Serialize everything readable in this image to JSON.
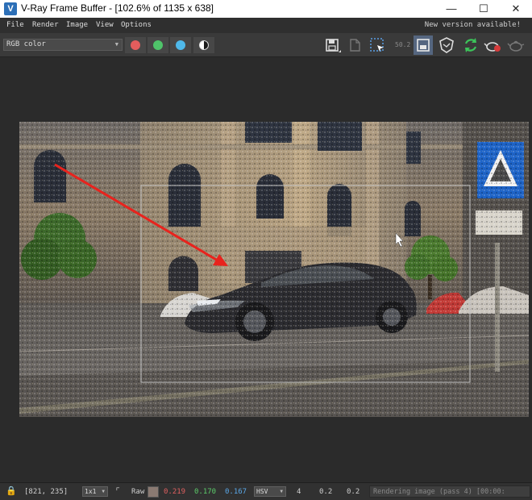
{
  "window": {
    "title": "V-Ray Frame Buffer - [102.6% of 1135 x 638]",
    "app_icon": "V"
  },
  "menu": {
    "items": [
      "File",
      "Render",
      "Image",
      "View",
      "Options"
    ],
    "notice": "New version available!"
  },
  "toolbar": {
    "channel": "RGB color",
    "sample_label": "50.2"
  },
  "colors": {
    "red": "#e35d5d",
    "green": "#4fc46a",
    "blue": "#4fb9ea"
  },
  "status": {
    "coords": "[821, 235]",
    "zoom": "1x1",
    "mode": "Raw",
    "r": "0.219",
    "g": "0.170",
    "b": "0.167",
    "colorspace": "HSV",
    "h": "4",
    "s": "0.2",
    "v": "0.2",
    "progress_text": "Rendering image (pass 4) [00:00:"
  }
}
